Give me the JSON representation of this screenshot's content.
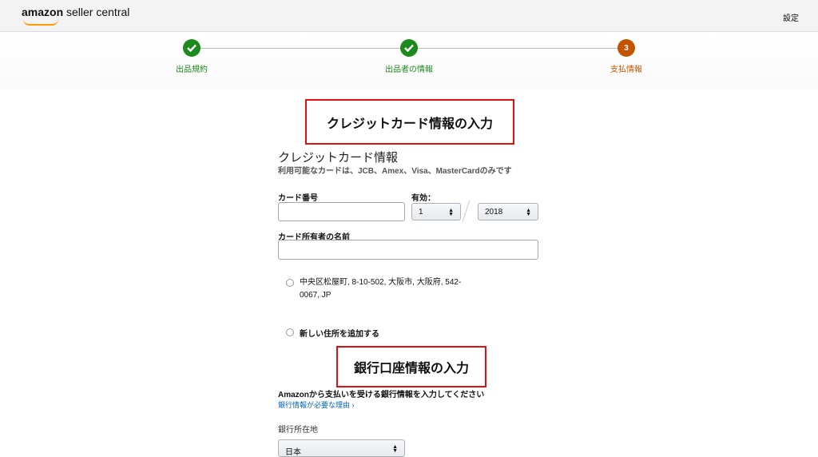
{
  "header": {
    "logo_bold": "amazon",
    "logo_rest": " seller central",
    "settings_label": "設定"
  },
  "steps": [
    {
      "label": "出品規約",
      "state": "done"
    },
    {
      "label": "出品者の情報",
      "state": "done"
    },
    {
      "label": "支払情報",
      "state": "current",
      "number": "3"
    }
  ],
  "callouts": {
    "credit_card": "クレジットカード情報の入力",
    "bank": "銀行口座情報の入力"
  },
  "credit_card": {
    "title": "クレジットカード情報",
    "subtitle": "利用可能なカードは、JCB、Amex、Visa、MasterCardのみです",
    "card_number_label": "カード番号",
    "card_number_value": "",
    "expiry_label": "有効：",
    "expiry_month": "1",
    "expiry_year": "2018",
    "holder_label": "カード所有者の名前",
    "holder_value": ""
  },
  "address": {
    "existing": "中央区松屋町, 8-10-502, 大阪市, 大阪府, 542-0067, JP",
    "add_new": "新しい住所を追加する"
  },
  "bank": {
    "heading": "Amazonから支払いを受ける銀行情報を入力してください",
    "why_link": "銀行情報が必要な理由 ›",
    "location_label": "銀行所在地",
    "location_value": "日本"
  },
  "colors": {
    "done": "#1d8a1d",
    "current": "#c45500",
    "callout_border": "#e01010",
    "link": "#0066c0"
  }
}
